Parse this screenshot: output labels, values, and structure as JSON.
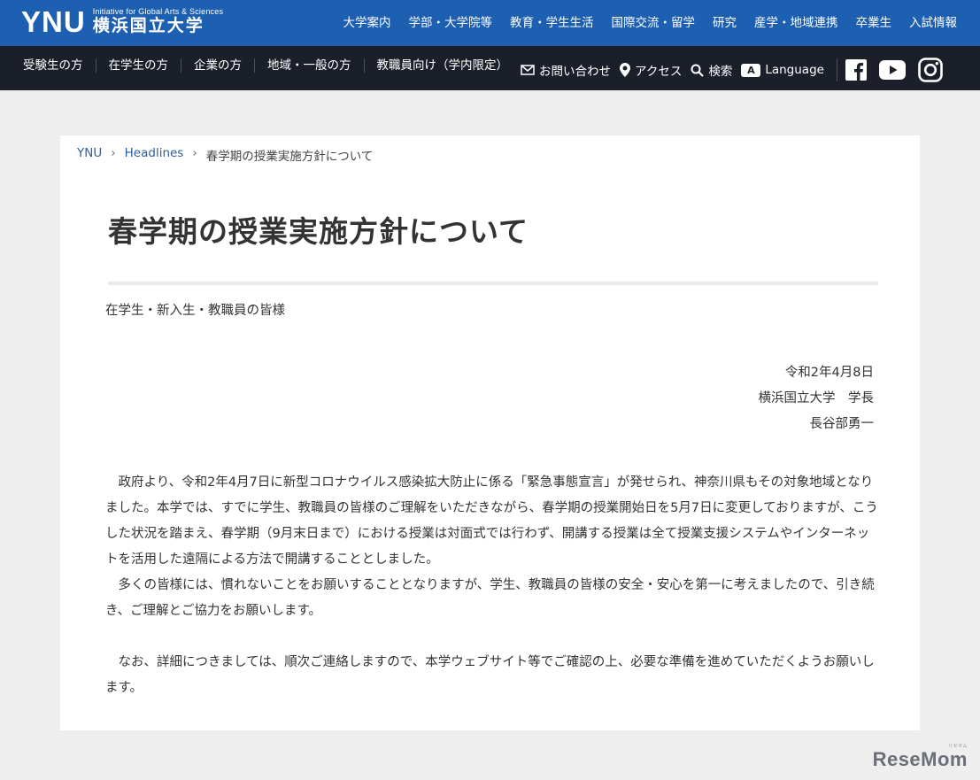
{
  "header": {
    "logo_text": "YNU",
    "logo_tagline": "Initiative for Global Arts & Sciences",
    "logo_jp": "横浜国立大学",
    "nav": [
      "大学案内",
      "学部・大学院等",
      "教育・学生生活",
      "国際交流・留学",
      "研究",
      "産学・地域連携",
      "卒業生",
      "入試情報"
    ]
  },
  "subnav": {
    "audience": [
      "受験生の方",
      "在学生の方",
      "企業の方",
      "地域・一般の方",
      "教職員向け（学内限定）"
    ],
    "utility": {
      "contact": "お問い合わせ",
      "access": "アクセス",
      "search": "検索",
      "lang_badge": "A",
      "language": "Language"
    },
    "sns": [
      "facebook-icon",
      "youtube-icon",
      "instagram-icon"
    ]
  },
  "breadcrumb": {
    "items": [
      "YNU",
      "Headlines"
    ],
    "current": "春学期の授業実施方針について",
    "separator": "›"
  },
  "article": {
    "title": "春学期の授業実施方針について",
    "addressee": "在学生・新入生・教職員の皆様",
    "date": "令和2年4月8日",
    "signer_title": "横浜国立大学　学長",
    "signer_name": "長谷部勇一",
    "paragraphs": [
      "政府より、令和2年4月7日に新型コロナウイルス感染拡大防止に係る「緊急事態宣言」が発せられ、神奈川県もその対象地域となりました。本学では、すでに学生、教職員の皆様のご理解をいただきながら、春学期の授業開始日を5月7日に変更しておりますが、こうした状況を踏まえ、春学期（9月末日まで）における授業は対面式では行わず、開講する授業は全て授業支援システムやインターネットを活用した遠隔による方法で開講することとしました。",
      "多くの皆様には、慣れないことをお願いすることとなりますが、学生、教職員の皆様の安全・安心を第一に考えましたので、引き続き、ご理解とご協力をお願いします。",
      "なお、詳細につきましては、順次ご連絡しますので、本学ウェブサイト等でご確認の上、必要な準備を進めていただくようお願いします。"
    ]
  },
  "watermark": {
    "text": "ReseMom",
    "sub": "リセマム"
  },
  "colors": {
    "top_bar": "#1d5fb0",
    "sub_bar": "#1b1f2a",
    "background": "#eeeeee",
    "link": "#2b5fa5"
  }
}
